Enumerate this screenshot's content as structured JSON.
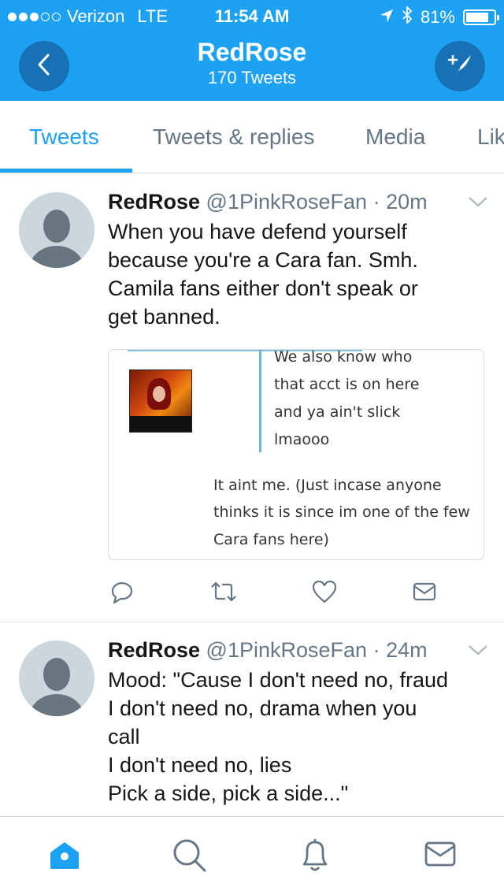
{
  "status_bar": {
    "carrier": "Verizon",
    "network": "LTE",
    "time": "11:54 AM",
    "battery_percent": "81%",
    "signal_bars_filled": 3,
    "signal_bars_total": 5
  },
  "header": {
    "title": "RedRose",
    "subtitle": "170 Tweets"
  },
  "tabs": [
    "Tweets",
    "Tweets & replies",
    "Media",
    "Likes"
  ],
  "active_tab": "Tweets",
  "tweets": [
    {
      "name": "RedRose",
      "handle": "@1PinkRoseFan",
      "time": "20m",
      "lines": [
        "When you have defend yourself",
        "because you're a Cara fan. Smh.",
        "Camila fans either don't speak or",
        "get banned."
      ],
      "media": {
        "quote_lines": [
          "We also know who",
          "that acct is on here",
          "and ya ain't slick",
          "lmaooo"
        ],
        "reply_lines": [
          "It aint me. (Just incase anyone",
          "thinks it is since im one of the few",
          "Cara fans here)"
        ]
      }
    },
    {
      "name": "RedRose",
      "handle": "@1PinkRoseFan",
      "time": "24m",
      "lines": [
        "Mood: \"Cause I don't need no, fraud",
        "I don't need no, drama when you",
        "call",
        "I don't need no, lies",
        "Pick a side, pick a side...\""
      ]
    }
  ],
  "colors": {
    "brand": "#1da1f2",
    "header_button": "#1671b5",
    "muted": "#657786"
  }
}
